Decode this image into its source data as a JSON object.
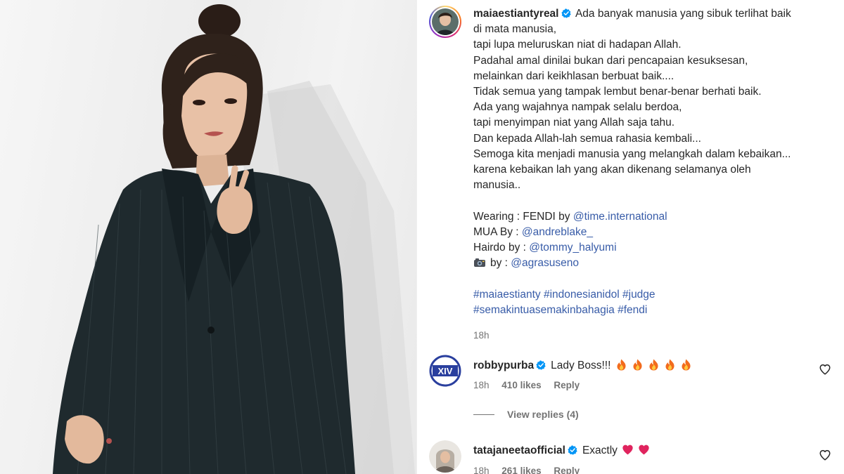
{
  "post": {
    "username": "maiaestiantyreal",
    "verified": true,
    "caption_lines": [
      "Ada banyak manusia yang sibuk terlihat baik",
      "di mata manusia,",
      "tapi lupa meluruskan niat di hadapan Allah.",
      "Padahal amal dinilai bukan dari pencapaian kesuksesan,",
      "melainkan dari keikhlasan berbuat baik....",
      "Tidak semua yang tampak lembut benar-benar berhati baik.",
      "Ada yang wajahnya nampak selalu berdoa,",
      "tapi menyimpan niat yang Allah saja tahu.",
      "Dan kepada Allah-lah semua rahasia kembali...",
      "Semoga kita menjadi manusia yang melangkah dalam kebaikan...",
      "karena kebaikan lah yang akan dikenang selamanya oleh",
      "manusia.."
    ],
    "credits": {
      "wearing_label": "Wearing : FENDI by ",
      "wearing_mention": "@time.international",
      "mua_label": "MUA By : ",
      "mua_mention": "@andreblake_",
      "hairdo_label": "Hairdo by : ",
      "hairdo_mention": "@tommy_halyumi",
      "photo_label": "by : ",
      "photo_mention": "@agrasuseno"
    },
    "hashtags": {
      "line1": [
        "#maiaestianty",
        "#indonesianidol",
        "#judge"
      ],
      "line2": [
        "#semakintuasemakinbahagia",
        "#fendi"
      ]
    },
    "time": "18h"
  },
  "comments": [
    {
      "username": "robbypurba",
      "verified": true,
      "text": "Lady Boss!!!",
      "emoji": "fire",
      "emoji_count": 5,
      "time": "18h",
      "likes": "410 likes",
      "reply": "Reply",
      "avatar_text": "XIV"
    },
    {
      "username": "tatajaneetaofficial",
      "verified": true,
      "text": "Exactly",
      "emoji": "red-heart",
      "emoji_count": 2,
      "time": "18h",
      "likes": "261 likes",
      "reply": "Reply"
    }
  ],
  "view_replies": "View replies (4)",
  "colors": {
    "link": "#385ca8",
    "muted": "#737373",
    "verified": "#0095f6",
    "text": "#262626"
  },
  "icons": [
    "verified-badge-icon",
    "heart-outline-icon",
    "camera-emoji-icon",
    "fire-emoji-icon",
    "red-heart-emoji-icon"
  ]
}
